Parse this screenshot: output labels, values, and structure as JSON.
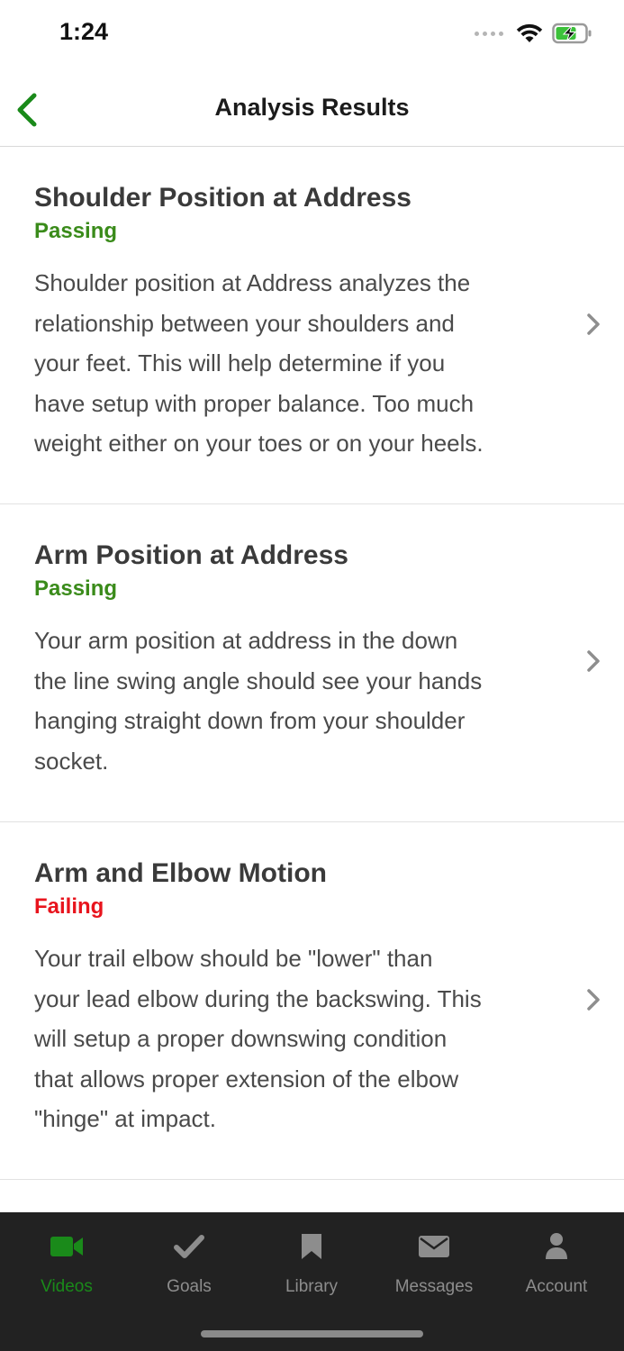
{
  "status_bar": {
    "time": "1:24"
  },
  "nav": {
    "title": "Analysis Results"
  },
  "items": [
    {
      "title": "Shoulder Position at Address",
      "status": "Passing",
      "status_color": "#3a8b1a",
      "lines": [
        "Shoulder position at Address analyzes the",
        "relationship between your shoulders and",
        "your feet. This will help determine if you",
        "have setup with proper balance. Too much",
        "weight either on your toes or on your heels."
      ]
    },
    {
      "title": "Arm Position at Address",
      "status": "Passing",
      "status_color": "#3a8b1a",
      "lines": [
        "Your arm position at address in the down",
        "the line swing angle should see your hands",
        "hanging straight down from your shoulder",
        "socket."
      ]
    },
    {
      "title": "Arm and Elbow Motion",
      "status": "Failing",
      "status_color": "#e8141d",
      "lines": [
        "Your trail elbow should be \"lower\" than",
        "your lead elbow during the backswing. This",
        "will setup a proper downswing condition",
        "that allows proper extension of the elbow",
        "\"hinge\" at impact."
      ]
    }
  ],
  "tabs": [
    {
      "label": "Videos",
      "icon": "video-camera-icon",
      "active": true
    },
    {
      "label": "Goals",
      "icon": "checkmark-icon",
      "active": false
    },
    {
      "label": "Library",
      "icon": "bookmark-icon",
      "active": false
    },
    {
      "label": "Messages",
      "icon": "envelope-icon",
      "active": false
    },
    {
      "label": "Account",
      "icon": "person-icon",
      "active": false
    }
  ],
  "colors": {
    "accent_green": "#1a8a1a",
    "passing": "#3a8b1a",
    "failing": "#e8141d",
    "tabbar_bg": "#222222"
  }
}
